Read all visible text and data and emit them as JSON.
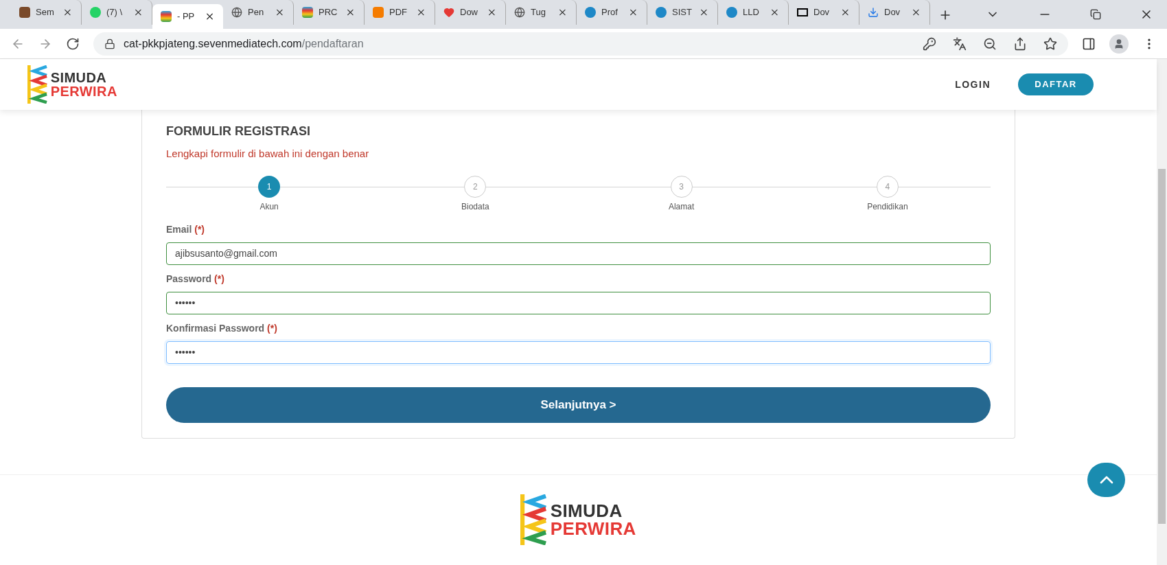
{
  "browser": {
    "tabs": [
      {
        "title": "Sem",
        "selected": false
      },
      {
        "title": "(7) \\",
        "selected": false
      },
      {
        "title": "- PP",
        "selected": true
      },
      {
        "title": "Pen",
        "selected": false
      },
      {
        "title": "PRC",
        "selected": false
      },
      {
        "title": "PDF",
        "selected": false
      },
      {
        "title": "Dow",
        "selected": false
      },
      {
        "title": "Tug",
        "selected": false
      },
      {
        "title": "Prof",
        "selected": false
      },
      {
        "title": "SIST",
        "selected": false
      },
      {
        "title": "LLD",
        "selected": false
      },
      {
        "title": "Dov",
        "selected": false
      },
      {
        "title": "Dov",
        "selected": false
      }
    ],
    "url_host": "cat-pkkpjateng.sevenmediatech.com",
    "url_path": "/pendaftaran"
  },
  "header": {
    "logo": {
      "line1": "SIMUDA",
      "line2": "PERWIRA"
    },
    "nav": [
      {
        "label": "LOGIN",
        "kind": "link"
      },
      {
        "label": "DAFTAR",
        "kind": "button"
      }
    ]
  },
  "form": {
    "title": "FORMULIR REGISTRASI",
    "subtitle": "Lengkapi formulir di bawah ini dengan benar",
    "steps": [
      {
        "number": "1",
        "label": "Akun",
        "selected": true
      },
      {
        "number": "2",
        "label": "Biodata",
        "selected": false
      },
      {
        "number": "3",
        "label": "Alamat",
        "selected": false
      },
      {
        "number": "4",
        "label": "Pendidikan",
        "selected": false
      }
    ],
    "fields": [
      {
        "label": "Email",
        "required": "(*)",
        "value": "ajibsusanto@gmail.com",
        "focused": false
      },
      {
        "label": "Password",
        "required": "(*)",
        "value": "••••••",
        "focused": false
      },
      {
        "label": "Konfirmasi Password",
        "required": "(*)",
        "value": "••••••",
        "focused": true
      }
    ],
    "submit": "Selanjutnya >"
  },
  "footer": {
    "logo": {
      "line1": "SIMUDA",
      "line2": "PERWIRA"
    }
  }
}
